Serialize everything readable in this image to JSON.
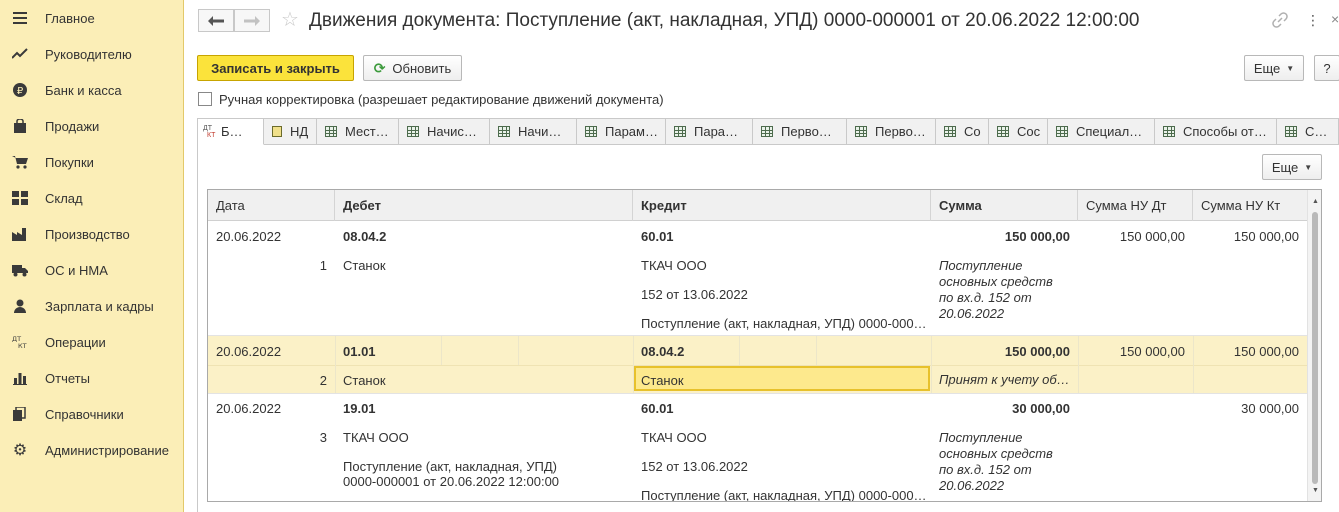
{
  "sidebar": {
    "items": [
      {
        "label": "Главное",
        "icon": "hamburger-icon"
      },
      {
        "label": "Руководителю",
        "icon": "trend-icon"
      },
      {
        "label": "Банк и касса",
        "icon": "ruble-coin-icon"
      },
      {
        "label": "Продажи",
        "icon": "bag-icon"
      },
      {
        "label": "Покупки",
        "icon": "cart-icon"
      },
      {
        "label": "Склад",
        "icon": "shelf-icon"
      },
      {
        "label": "Производство",
        "icon": "factory-icon"
      },
      {
        "label": "ОС и НМА",
        "icon": "truck-icon"
      },
      {
        "label": "Зарплата и кадры",
        "icon": "person-icon"
      },
      {
        "label": "Операции",
        "icon": "dt-kt-icon"
      },
      {
        "label": "Отчеты",
        "icon": "bar-chart-icon"
      },
      {
        "label": "Справочники",
        "icon": "books-icon"
      },
      {
        "label": "Администрирование",
        "icon": "gear-icon"
      }
    ]
  },
  "header": {
    "back_glyph": "🡐",
    "forward_glyph": "🡒",
    "title": "Движения документа: Поступление (акт, накладная, УПД) 0000-000001 от 20.06.2022 12:00:00"
  },
  "toolbar": {
    "save_close": "Записать и закрыть",
    "refresh": "Обновить",
    "more": "Еще",
    "help": "?"
  },
  "manual_edit": {
    "label": "Ручная корректировка (разрешает редактирование движений документа)",
    "checked": false
  },
  "tabs": [
    {
      "label": "Б…",
      "icon": "dt-kt-icon",
      "active": true
    },
    {
      "label": "НД",
      "icon": "tax-register-icon"
    },
    {
      "label": "Мест…",
      "icon": "register-table-icon"
    },
    {
      "label": "Начис…",
      "icon": "register-table-icon"
    },
    {
      "label": "Начи…",
      "icon": "register-table-icon"
    },
    {
      "label": "Парам…",
      "icon": "register-table-icon"
    },
    {
      "label": "Пара…",
      "icon": "register-table-icon"
    },
    {
      "label": "Перво…",
      "icon": "register-table-icon"
    },
    {
      "label": "Перво…",
      "icon": "register-table-icon"
    },
    {
      "label": "Со",
      "icon": "register-table-icon"
    },
    {
      "label": "Сос",
      "icon": "register-table-icon"
    },
    {
      "label": "Специал…",
      "icon": "register-table-icon"
    },
    {
      "label": "Способы от…",
      "icon": "register-table-icon"
    },
    {
      "label": "С…",
      "icon": "register-table-icon"
    }
  ],
  "panel": {
    "more": "Еще"
  },
  "table": {
    "columns": [
      "Дата",
      "Дебет",
      "Кредит",
      "Сумма",
      "Сумма НУ Дт",
      "Сумма НУ Кт"
    ],
    "rows": [
      {
        "date": "20.06.2022",
        "num": "1",
        "debit_account": "08.04.2",
        "debit_sub1": "Станок",
        "debit_sub2": "",
        "credit_account": "60.01",
        "credit_sub1": "ТКАЧ ООО",
        "credit_sub2": "152 от 13.06.2022",
        "credit_sub3": "Поступление (акт, накладная, УПД) 0000-000…",
        "amount": "150 000,00",
        "content": "Поступление основных средств по вх.д. 152 от 20.06.2022",
        "nu_dt": "150 000,00",
        "nu_kt": "150 000,00"
      },
      {
        "date": "20.06.2022",
        "num": "2",
        "debit_account": "01.01",
        "debit_sub1": "Станок",
        "credit_account": "08.04.2",
        "credit_sub1": "Станок",
        "amount": "150 000,00",
        "content": "Принят к учету об…",
        "nu_dt": "150 000,00",
        "nu_kt": "150 000,00",
        "selected": true
      },
      {
        "date": "20.06.2022",
        "num": "3",
        "debit_account": "19.01",
        "debit_sub1": "ТКАЧ ООО",
        "debit_sub2": "Поступление (акт, накладная, УПД) 0000-000001 от 20.06.2022 12:00:00",
        "credit_account": "60.01",
        "credit_sub1": "ТКАЧ ООО",
        "credit_sub2": "152 от 13.06.2022",
        "credit_sub3": "Поступление (акт, накладная, УПД) 0000-000…",
        "amount": "30 000,00",
        "content": "Поступление основных средств по вх.д. 152 от 20.06.2022",
        "nu_dt": "",
        "nu_kt": "30 000,00"
      }
    ]
  }
}
